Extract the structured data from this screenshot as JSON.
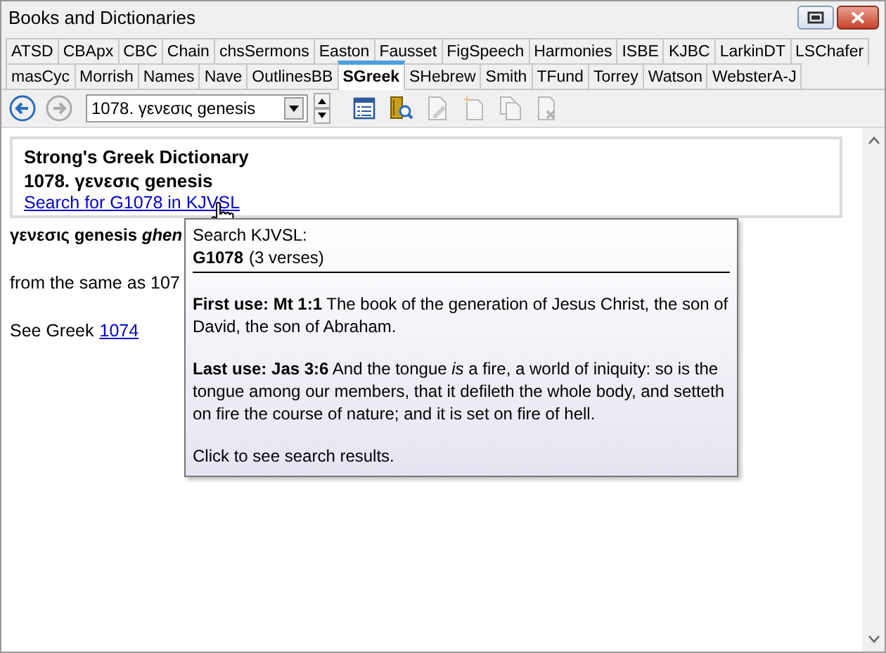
{
  "window": {
    "title": "Books and Dictionaries"
  },
  "tab_rows": [
    [
      {
        "label": "ATSD",
        "selected": false
      },
      {
        "label": "CBApx",
        "selected": false
      },
      {
        "label": "CBC",
        "selected": false
      },
      {
        "label": "Chain",
        "selected": false
      },
      {
        "label": "chsSermons",
        "selected": false
      },
      {
        "label": "Easton",
        "selected": false
      },
      {
        "label": "Fausset",
        "selected": false
      },
      {
        "label": "FigSpeech",
        "selected": false
      },
      {
        "label": "Harmonies",
        "selected": false
      },
      {
        "label": "ISBE",
        "selected": false
      },
      {
        "label": "KJBC",
        "selected": false
      },
      {
        "label": "LarkinDT",
        "selected": false
      },
      {
        "label": "LSChafer",
        "selected": false
      }
    ],
    [
      {
        "label": "masCyc",
        "selected": false
      },
      {
        "label": "Morrish",
        "selected": false
      },
      {
        "label": "Names",
        "selected": false
      },
      {
        "label": "Nave",
        "selected": false
      },
      {
        "label": "OutlinesBB",
        "selected": false
      },
      {
        "label": "SGreek",
        "selected": true
      },
      {
        "label": "SHebrew",
        "selected": false
      },
      {
        "label": "Smith",
        "selected": false
      },
      {
        "label": "TFund",
        "selected": false
      },
      {
        "label": "Torrey",
        "selected": false
      },
      {
        "label": "Watson",
        "selected": false
      },
      {
        "label": "WebsterA-J",
        "selected": false
      }
    ]
  ],
  "toolbar": {
    "back": {
      "disabled": false
    },
    "forward": {
      "disabled": true
    },
    "entry_select": {
      "value": "1078. γενεσις genesis"
    },
    "tools": [
      {
        "kind": "list",
        "disabled": false
      },
      {
        "kind": "book-search",
        "disabled": false
      },
      {
        "kind": "edit",
        "disabled": true
      },
      {
        "kind": "new",
        "disabled": true
      },
      {
        "kind": "copy",
        "disabled": true
      },
      {
        "kind": "delete",
        "disabled": true
      }
    ]
  },
  "header": {
    "title": "Strong's Greek Dictionary",
    "entry": "1078. γενεσις genesis",
    "link": "Search for G1078 in KJVSL"
  },
  "body": {
    "headword": "γενεσις genesis *ghen*",
    "derivation": "from the same as 107",
    "see_label": "See Greek",
    "see_link": "1074"
  },
  "tooltip": {
    "heading": "Search KJVSL:",
    "code": "G1078",
    "count": "(3 verses)",
    "uses": [
      {
        "label": "First use: Mt 1:1",
        "text": "The book of the generation of Jesus Christ, the son of David, the son of Abraham."
      },
      {
        "label": "Last use: Jas 3:6",
        "text": "And the tongue *is* a fire, a world of iniquity: so is the tongue among our members, that it defileth the whole body, and setteth on fire the course of nature; and it is set on fire of hell."
      }
    ],
    "footer": "Click to see search results."
  }
}
